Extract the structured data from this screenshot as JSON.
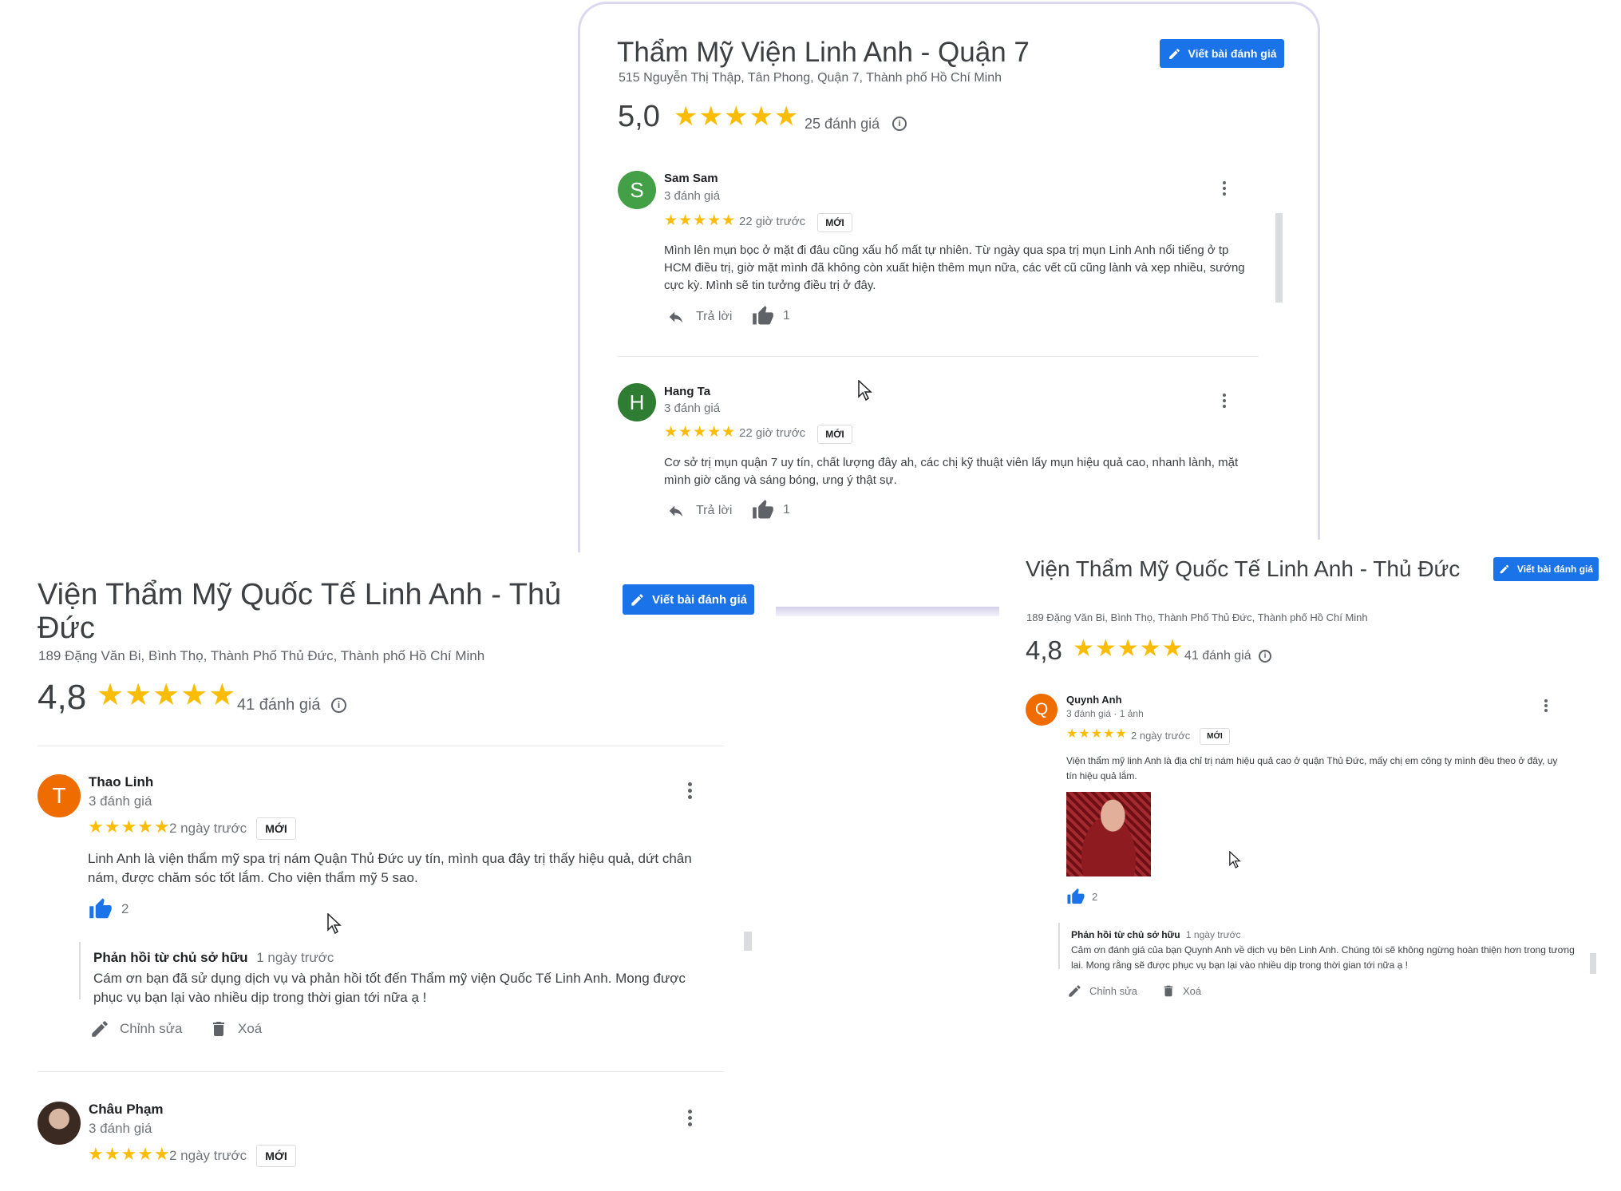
{
  "top_card": {
    "title": "Thẩm Mỹ Viện Linh Anh - Quận 7",
    "address": "515 Nguyễn Thị Thập, Tân Phong, Quận 7, Thành phố Hồ Chí Minh",
    "write_review_label": "Viết bài đánh giá",
    "rating": "5,0",
    "rating_value": 5,
    "review_count": "25 đánh giá",
    "reviews": [
      {
        "initial": "S",
        "avatar_color": "#43a047",
        "name": "Sam Sam",
        "meta": "3 đánh giá",
        "stars": 5,
        "time": "22 giờ trước",
        "badge": "MỚI",
        "text": "Mình lên mụn bọc ở mặt đi đâu cũng xấu hổ mất tự nhiên. Từ ngày qua spa trị mụn Linh Anh nổi tiếng ở tp HCM điều trị, giờ mặt mình đã không còn xuất hiện thêm mụn nữa, các vết cũ cũng lành và xẹp nhiều, sướng cực kỳ. Mình sẽ tin tưởng điều trị ở đây.",
        "reply_label": "Trả lời",
        "likes": "1"
      },
      {
        "initial": "H",
        "avatar_color": "#2e7d32",
        "name": "Hang Ta",
        "meta": "3 đánh giá",
        "stars": 5,
        "time": "22 giờ trước",
        "badge": "MỚI",
        "text": "Cơ sở trị mụn quận 7 uy tín, chất lượng đây ah, các chị kỹ thuật viên lấy mụn hiệu quả cao, nhanh lành, mặt mình giờ căng và sáng bóng, ưng ý thật sự.",
        "reply_label": "Trả lời",
        "likes": "1"
      }
    ]
  },
  "left_card": {
    "title": "Viện Thẩm Mỹ Quốc Tế Linh Anh - Thủ Đức",
    "address": "189 Đặng Văn Bi, Bình Thọ, Thành Phố Thủ Đức, Thành phố Hồ Chí Minh",
    "write_review_label": "Viết bài đánh giá",
    "rating": "4,8",
    "rating_value": 4.8,
    "review_count": "41 đánh giá",
    "review": {
      "initial": "T",
      "avatar_color": "#ef6c00",
      "name": "Thao Linh",
      "meta": "3 đánh giá",
      "stars": 5,
      "time": "2 ngày trước",
      "badge": "MỚI",
      "text": "Linh Anh là viện thẩm mỹ spa trị nám Quận Thủ Đức uy tín, mình qua đây trị thấy hiệu quả, dứt chân nám, được chăm sóc tốt lắm. Cho viện thẩm mỹ 5 sao.",
      "likes": "2",
      "owner_title": "Phản hồi từ chủ sở hữu",
      "owner_time": "1 ngày trước",
      "owner_text": "Cám ơn bạn đã sử dụng dịch vụ và phản hồi tốt đến Thẩm mỹ viện Quốc Tế Linh Anh. Mong được phục vụ bạn lại vào nhiều dịp trong thời gian tới nữa ạ !",
      "edit_label": "Chỉnh sửa",
      "delete_label": "Xoá"
    },
    "next_review": {
      "name": "Châu Phạm",
      "meta": "3 đánh giá",
      "stars": 5,
      "time": "2 ngày trước",
      "badge": "MỚI"
    }
  },
  "right_card": {
    "title": "Viện Thẩm Mỹ Quốc Tế Linh Anh - Thủ Đức",
    "address": "189 Đặng Văn Bi, Bình Thọ, Thành Phố Thủ Đức, Thành phố Hồ Chí Minh",
    "write_review_label": "Viết bài đánh giá",
    "rating": "4,8",
    "rating_value": 4.8,
    "review_count": "41 đánh giá",
    "review": {
      "initial": "Q",
      "avatar_color": "#ef6c00",
      "name": "Quynh Anh",
      "meta": "3 đánh giá · 1 ảnh",
      "stars": 5,
      "time": "2 ngày trước",
      "badge": "MỚI",
      "text": "Viện thẩm mỹ linh Anh là địa chỉ trị nám hiệu quả cao ở quận Thủ Đức, mấy chị em công ty mình đều theo ở đây, uy tín hiệu quả lắm.",
      "likes": "2",
      "owner_title": "Phản hồi từ chủ sở hữu",
      "owner_time": "1 ngày trước",
      "owner_text": "Cảm ơn đánh giá của bạn Quynh Anh về dịch vụ bên Linh Anh. Chúng tôi sẽ không ngừng hoàn thiện hơn trong tương lai. Mong rằng sẽ được phục vụ bạn lại vào nhiều dịp trong thời gian tới nữa ạ !",
      "edit_label": "Chỉnh sửa",
      "delete_label": "Xoá"
    }
  },
  "colors": {
    "star": "#fbbc04",
    "button": "#1a73e8",
    "like": "#1a73e8"
  },
  "icons": [
    "pencil-icon",
    "info-icon",
    "star-icon",
    "kebab-menu-icon",
    "reply-arrow-icon",
    "thumbs-up-icon",
    "trash-icon",
    "mouse-cursor-icon"
  ]
}
